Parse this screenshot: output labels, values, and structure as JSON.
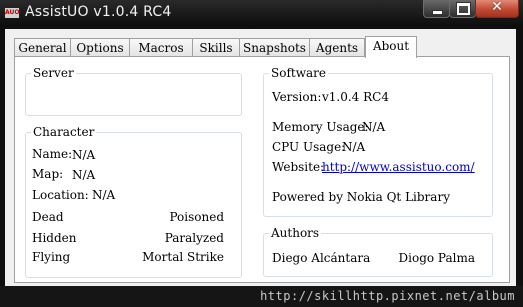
{
  "window": {
    "title": "AssistUO v1.0.4 RC4",
    "app_icon_text": "AUO",
    "controls": {
      "minimize": "minimize-icon",
      "maximize": "maximize-icon",
      "close": "✕"
    }
  },
  "tabs": [
    {
      "label": "General",
      "active": false
    },
    {
      "label": "Options",
      "active": false
    },
    {
      "label": "Macros",
      "active": false
    },
    {
      "label": "Skills",
      "active": false
    },
    {
      "label": "Snapshots",
      "active": false
    },
    {
      "label": "Agents",
      "active": false
    },
    {
      "label": "About",
      "active": true
    }
  ],
  "server": {
    "title": "Server"
  },
  "character": {
    "title": "Character",
    "name_label": "Name:",
    "name_value": "N/A",
    "map_label": "Map:",
    "map_value": "N/A",
    "location_label": "Location:",
    "location_value": "N/A",
    "states": {
      "dead": "Dead",
      "poisoned": "Poisoned",
      "hidden": "Hidden",
      "paralyzed": "Paralyzed",
      "flying": "Flying",
      "mortal_strike": "Mortal Strike"
    }
  },
  "software": {
    "title": "Software",
    "version_label": "Version:",
    "version_value": "v1.0.4 RC4",
    "memory_label": "Memory Usage:",
    "memory_value": "N/A",
    "cpu_label": "CPU Usage:",
    "cpu_value": "N/A",
    "website_label": "Website:",
    "website_value": "http://www.assistuo.com/",
    "powered_by": "Powered by Nokia Qt Library"
  },
  "authors": {
    "title": "Authors",
    "names": [
      "Diego Alcántara",
      "Diogo Palma"
    ]
  },
  "watermark": "http://skillhttp.pixnet.net/album",
  "colors": {
    "link": "#0000cc",
    "close_button": "#c24a33",
    "group_border": "#d5dfe5"
  }
}
